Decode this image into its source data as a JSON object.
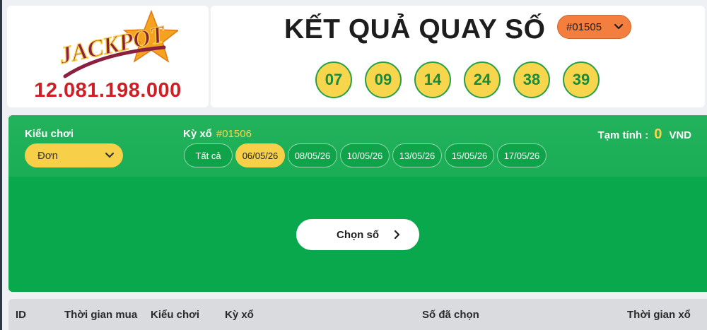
{
  "jackpot": {
    "logo_text": "JACKPOT",
    "amount": "12.081.198.000"
  },
  "results": {
    "title": "KẾT QUẢ QUAY SỐ",
    "draw_selected": "#01505",
    "numbers": [
      "07",
      "09",
      "14",
      "24",
      "38",
      "39"
    ]
  },
  "play": {
    "play_type_label": "Kiểu chơi",
    "play_type_value": "Đơn",
    "draw_label": "Kỳ xổ",
    "draw_number": "#01506",
    "date_tabs": [
      {
        "label": "Tất cả",
        "active": false
      },
      {
        "label": "06/05/26",
        "active": true
      },
      {
        "label": "08/05/26",
        "active": false
      },
      {
        "label": "10/05/26",
        "active": false
      },
      {
        "label": "13/05/26",
        "active": false
      },
      {
        "label": "15/05/26",
        "active": false
      },
      {
        "label": "17/05/26",
        "active": false
      }
    ],
    "estimate_label": "Tạm tính :",
    "estimate_amount": "0",
    "currency": "VND",
    "choose_button": "Chọn số"
  },
  "table": {
    "columns": [
      "ID",
      "Thời gian mua",
      "Kiểu chơi",
      "Kỳ xổ",
      "Số đã chọn",
      "Thời gian xổ"
    ]
  },
  "colors": {
    "green": "#0eaa4e",
    "yellow": "#f7cf48",
    "orange": "#f47e3e",
    "red": "#cf1f25"
  }
}
